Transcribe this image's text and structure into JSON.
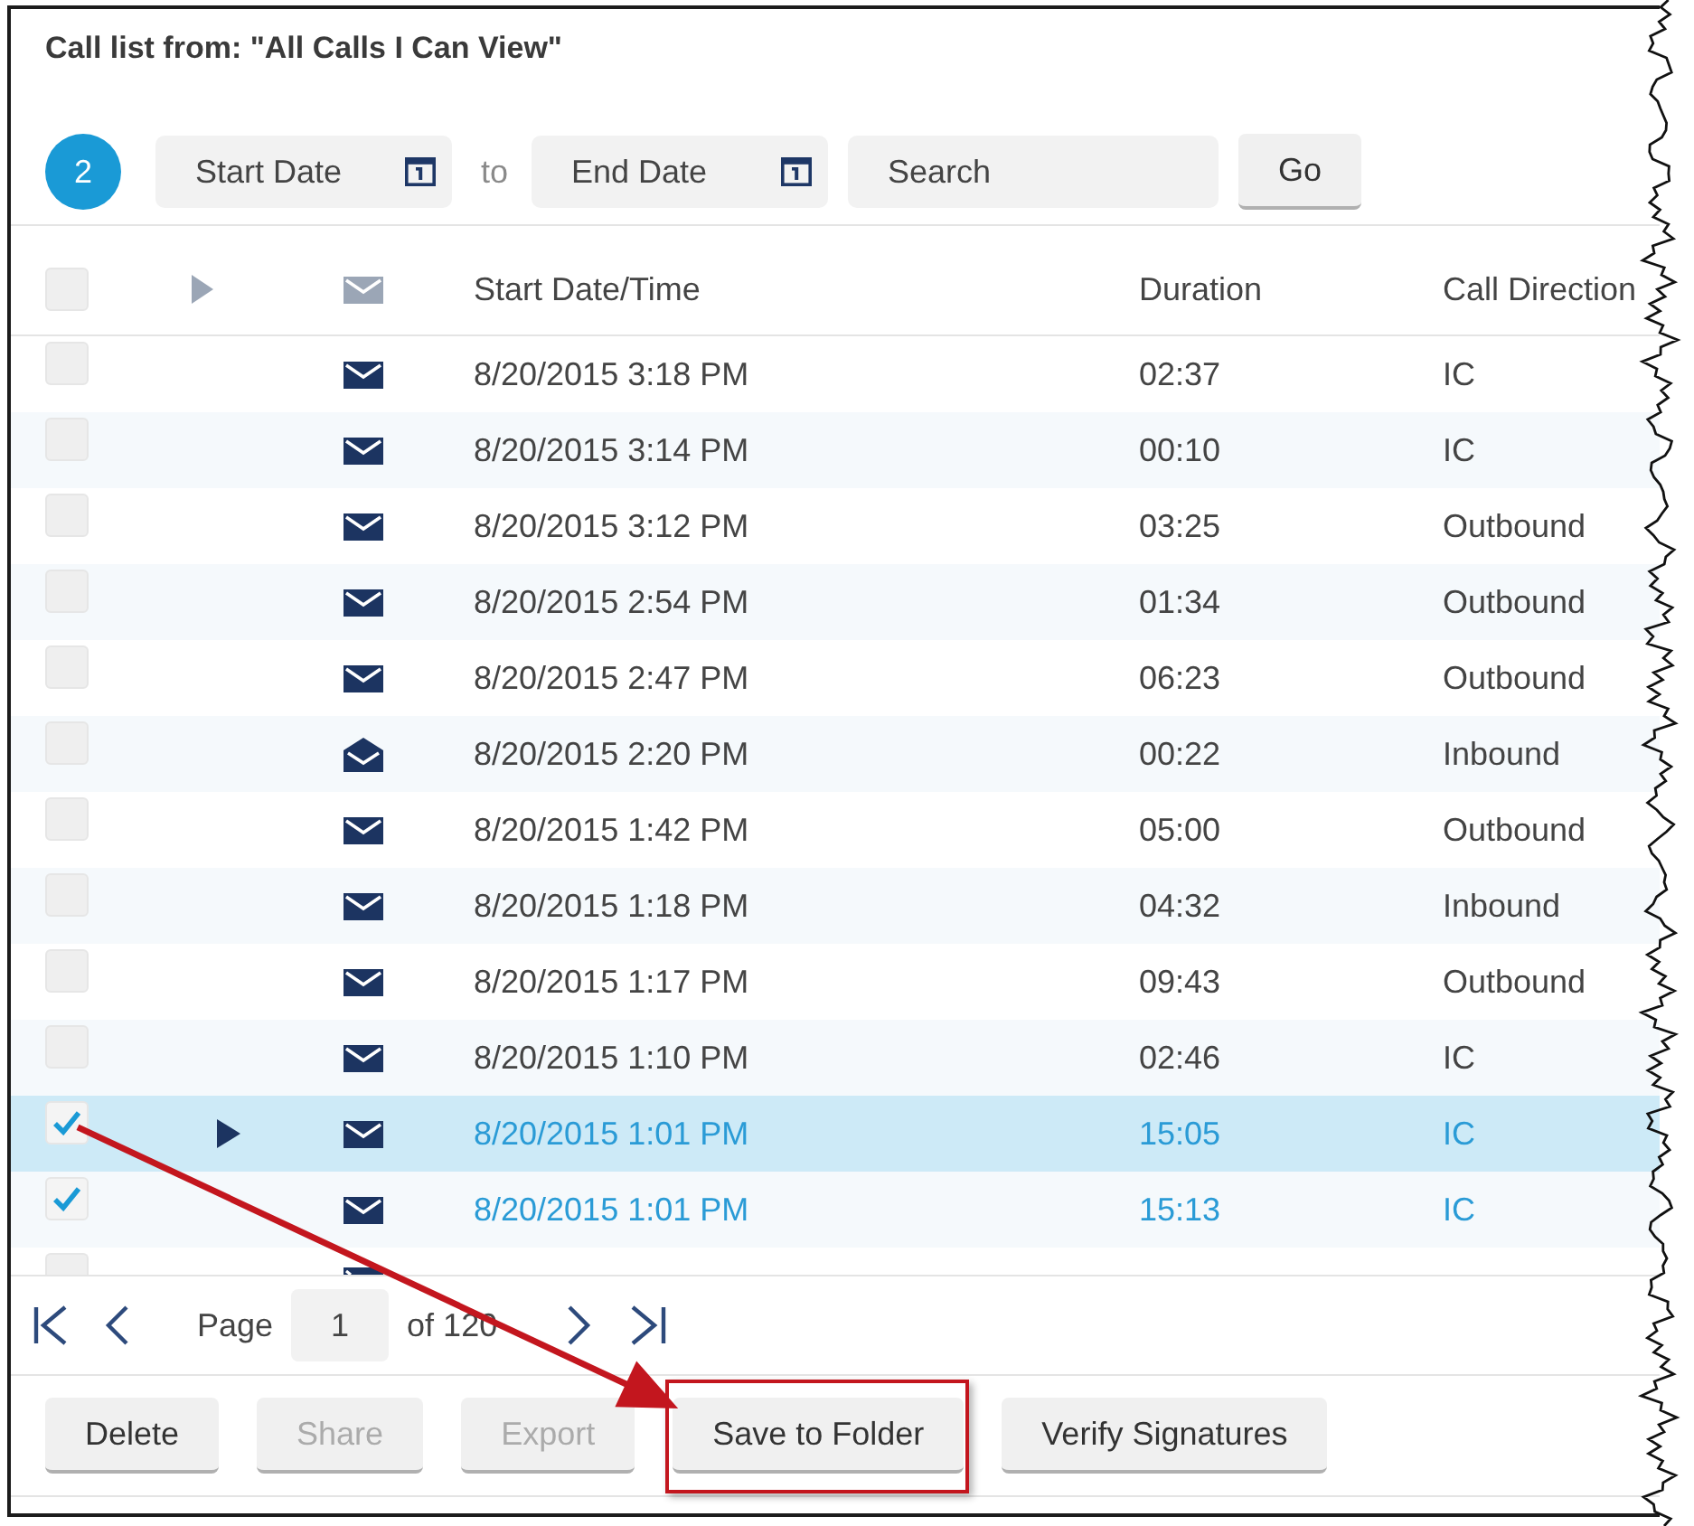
{
  "title": "Call list from: \"All Calls I Can View\"",
  "filters": {
    "badge": "2",
    "start_date": {
      "placeholder": "Start Date"
    },
    "separator": "to",
    "end_date": {
      "placeholder": "End Date"
    },
    "search": {
      "placeholder": "Search"
    },
    "go_button": "Go"
  },
  "table": {
    "header": {
      "checked": false,
      "columns": [
        "Start Date/Time",
        "Duration",
        "Call Direction"
      ]
    },
    "rows": [
      {
        "checked": false,
        "selected": false,
        "arrow_start": false,
        "envelope_open": false,
        "start": "8/20/2015 3:18 PM",
        "duration": "02:37",
        "direction": "IC"
      },
      {
        "checked": false,
        "selected": false,
        "arrow_start": false,
        "envelope_open": false,
        "start": "8/20/2015 3:14 PM",
        "duration": "00:10",
        "direction": "IC"
      },
      {
        "checked": false,
        "selected": false,
        "arrow_start": false,
        "envelope_open": false,
        "start": "8/20/2015 3:12 PM",
        "duration": "03:25",
        "direction": "Outbound"
      },
      {
        "checked": false,
        "selected": false,
        "arrow_start": false,
        "envelope_open": false,
        "start": "8/20/2015 2:54 PM",
        "duration": "01:34",
        "direction": "Outbound"
      },
      {
        "checked": false,
        "selected": false,
        "arrow_start": false,
        "envelope_open": false,
        "start": "8/20/2015 2:47 PM",
        "duration": "06:23",
        "direction": "Outbound"
      },
      {
        "checked": false,
        "selected": false,
        "arrow_start": false,
        "envelope_open": true,
        "start": "8/20/2015 2:20 PM",
        "duration": "00:22",
        "direction": "Inbound"
      },
      {
        "checked": false,
        "selected": false,
        "arrow_start": false,
        "envelope_open": false,
        "start": "8/20/2015 1:42 PM",
        "duration": "05:00",
        "direction": "Outbound"
      },
      {
        "checked": false,
        "selected": false,
        "arrow_start": false,
        "envelope_open": false,
        "start": "8/20/2015 1:18 PM",
        "duration": "04:32",
        "direction": "Inbound"
      },
      {
        "checked": false,
        "selected": false,
        "arrow_start": false,
        "envelope_open": false,
        "start": "8/20/2015 1:17 PM",
        "duration": "09:43",
        "direction": "Outbound"
      },
      {
        "checked": false,
        "selected": false,
        "arrow_start": false,
        "envelope_open": false,
        "start": "8/20/2015 1:10 PM",
        "duration": "02:46",
        "direction": "IC"
      },
      {
        "checked": true,
        "selected": true,
        "arrow_start": true,
        "envelope_open": false,
        "start": "8/20/2015 1:01 PM",
        "duration": "15:05",
        "direction": "IC"
      },
      {
        "checked": true,
        "selected": false,
        "arrow_start": false,
        "envelope_open": false,
        "start": "8/20/2015 1:01 PM",
        "duration": "15:13",
        "direction": "IC"
      }
    ],
    "partial_row": {
      "checked": false,
      "envelope_open": false
    }
  },
  "pagination": {
    "page_label": "Page",
    "page": "1",
    "total": "of 120"
  },
  "buttons": [
    {
      "label": "Delete",
      "disabled": false,
      "highlighted": false
    },
    {
      "label": "Share",
      "disabled": true,
      "highlighted": false
    },
    {
      "label": "Export",
      "disabled": true,
      "highlighted": false
    },
    {
      "label": "Save to Folder",
      "disabled": false,
      "highlighted": true
    },
    {
      "label": "Verify Signatures",
      "disabled": false,
      "highlighted": false
    }
  ]
}
